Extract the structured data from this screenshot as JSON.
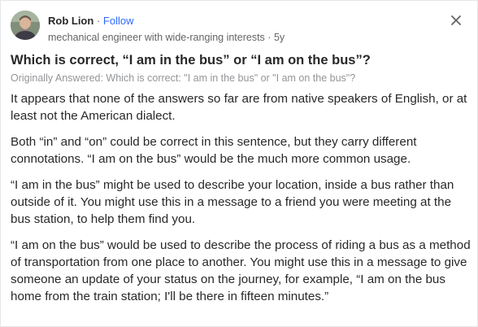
{
  "author": {
    "name": "Rob Lion",
    "separator": "·",
    "follow_label": "Follow",
    "credential": "mechanical engineer with wide-ranging interests",
    "time": "5y"
  },
  "question": {
    "title": "Which is correct, “I am in the bus” or “I am on the bus”?",
    "originally_answered": "Originally Answered: Which is correct: \"I am in the bus\" or \"I am on the bus\"?"
  },
  "answer": {
    "paragraphs": [
      "It appears that none of the answers so far are from native speakers of English, or at least not the American dialect.",
      "Both “in” and “on” could be correct in this sentence, but they carry different connotations. “I am on the bus” would be the much more common usage.",
      "“I am in the bus” might be used to describe your location, inside a bus rather than outside of it. You might use this in a message to a friend you were meeting at the bus station, to help them find you.",
      "“I am on the bus” would be used to describe the process of riding a bus as a method of transportation from one place to another. You might use this in a message to give someone an update of your status on the journey, for example, “I am on the bus home from the train station; I'll be there in fifteen minutes.”"
    ]
  },
  "icons": {
    "close": "close-icon",
    "avatar": "avatar"
  },
  "colors": {
    "link": "#2e69ff",
    "text": "#282829",
    "muted": "#636466",
    "faint": "#939598"
  }
}
